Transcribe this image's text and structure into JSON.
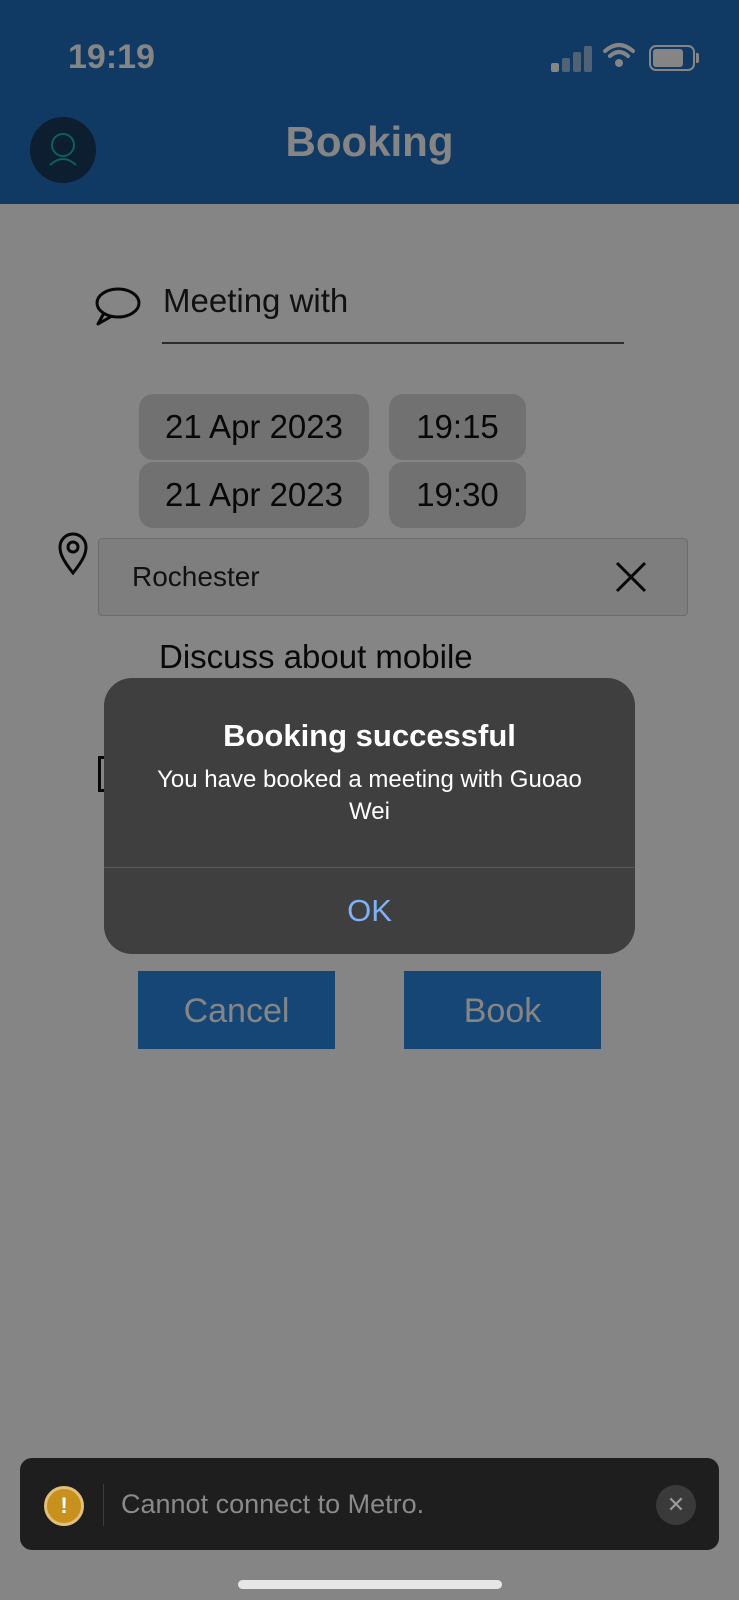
{
  "status_bar": {
    "time": "19:19",
    "icons": [
      "cellular-signal-icon",
      "wifi-icon",
      "battery-icon"
    ]
  },
  "header": {
    "title": "Booking",
    "avatar_icon": "profile-avatar-icon",
    "background_color": "#1f6fbf"
  },
  "form": {
    "meeting_label": "Meeting with",
    "start_date": "21 Apr 2023",
    "start_time": "19:15",
    "end_date": "21 Apr 2023",
    "end_time": "19:30",
    "location": "Rochester",
    "description": "Discuss about mobile",
    "cancel_label": "Cancel",
    "book_label": "Book",
    "button_color": "#2b86e0"
  },
  "alert": {
    "title": "Booking successful",
    "message": "You have booked a meeting with Guoao Wei",
    "ok_label": "OK"
  },
  "toast": {
    "icon": "warning-icon",
    "icon_glyph": "!",
    "message": "Cannot connect to Metro.",
    "close_glyph": "✕"
  }
}
